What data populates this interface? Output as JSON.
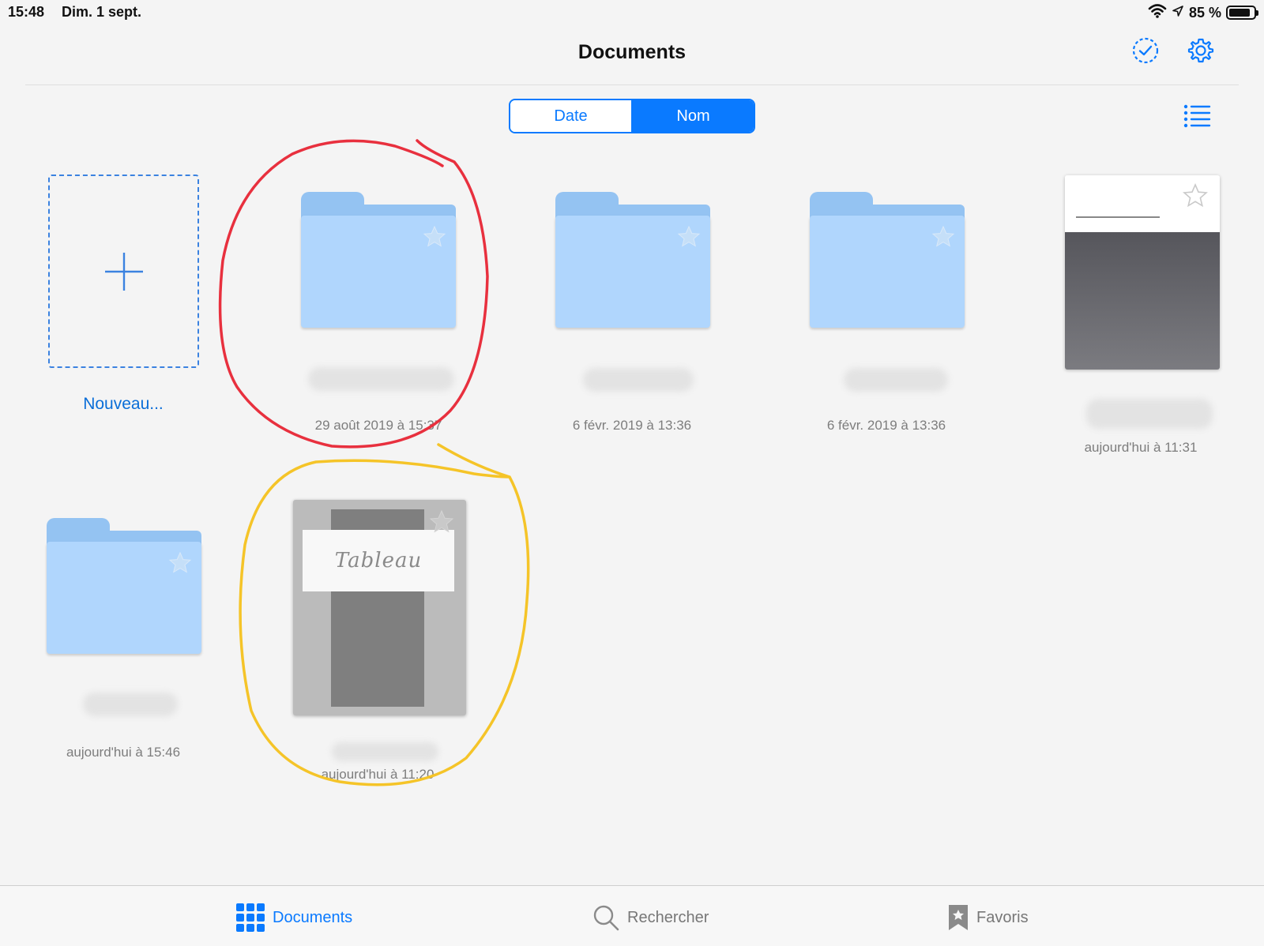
{
  "status_bar": {
    "time": "15:48",
    "date": "Dim. 1 sept.",
    "battery": "85 %",
    "battery_level": 0.85
  },
  "nav": {
    "title": "Documents",
    "select_icon": "dashed-check-circle-icon",
    "settings_icon": "gear-icon"
  },
  "sort": {
    "options": [
      "Date",
      "Nom"
    ],
    "selected": "Nom"
  },
  "view_toggle_icon": "list-view-icon",
  "new_item": {
    "label": "Nouveau..."
  },
  "items": [
    {
      "kind": "folder",
      "timestamp": "29 août 2019 à 15:37",
      "favorite": false
    },
    {
      "kind": "folder",
      "timestamp": "6 févr. 2019 à 13:36",
      "favorite": false
    },
    {
      "kind": "folder",
      "timestamp": "6 févr. 2019 à 13:36",
      "favorite": false
    },
    {
      "kind": "document",
      "timestamp": "aujourd'hui à 11:31",
      "favorite": false
    },
    {
      "kind": "folder",
      "timestamp": "aujourd'hui à 15:46",
      "favorite": false
    },
    {
      "kind": "document",
      "timestamp": "aujourd'hui à 11:20",
      "thumbnail_text": "Tableau",
      "favorite": false
    }
  ],
  "tabs": [
    {
      "label": "Documents",
      "icon": "grid-icon",
      "active": true
    },
    {
      "label": "Rechercher",
      "icon": "search-icon",
      "active": false
    },
    {
      "label": "Favoris",
      "icon": "bookmark-star-icon",
      "active": false
    }
  ],
  "colors": {
    "accent": "#0a7aff",
    "folder_body": "#b0d6fd",
    "folder_tab": "#94c3f2",
    "annotation_red": "#e8303e",
    "annotation_yellow": "#f5c428"
  }
}
